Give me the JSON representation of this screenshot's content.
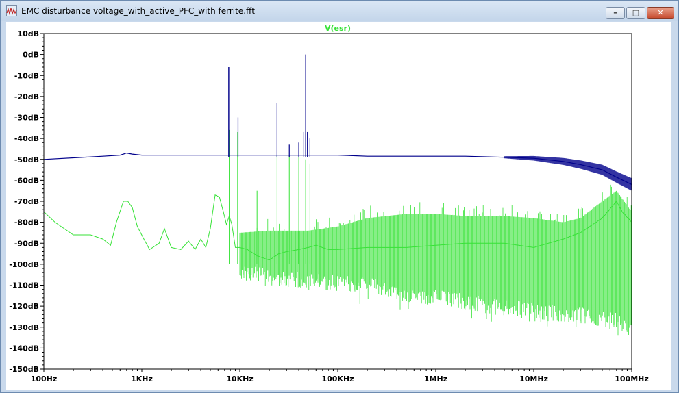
{
  "window": {
    "title": "EMC disturbance voltage_with_active_PFC_with ferrite.fft",
    "minimize_glyph": "–",
    "maximize_glyph": "□",
    "close_glyph": "✕"
  },
  "chart_data": {
    "type": "line",
    "title": "V(esr)",
    "x_scale": "log",
    "y_scale": "linear",
    "xlim": [
      100,
      100000000
    ],
    "ylim": [
      -150,
      10
    ],
    "x_ticks": [
      {
        "value": 100,
        "label": "100Hz"
      },
      {
        "value": 1000,
        "label": "1KHz"
      },
      {
        "value": 10000,
        "label": "10KHz"
      },
      {
        "value": 100000,
        "label": "100KHz"
      },
      {
        "value": 1000000,
        "label": "1MHz"
      },
      {
        "value": 10000000,
        "label": "10MHz"
      },
      {
        "value": 100000000,
        "label": "100MHz"
      }
    ],
    "y_ticks": [
      {
        "value": 10,
        "label": "10dB"
      },
      {
        "value": 0,
        "label": "0dB"
      },
      {
        "value": -10,
        "label": "-10dB"
      },
      {
        "value": -20,
        "label": "-20dB"
      },
      {
        "value": -30,
        "label": "-30dB"
      },
      {
        "value": -40,
        "label": "-40dB"
      },
      {
        "value": -50,
        "label": "-50dB"
      },
      {
        "value": -60,
        "label": "-60dB"
      },
      {
        "value": -70,
        "label": "-70dB"
      },
      {
        "value": -80,
        "label": "-80dB"
      },
      {
        "value": -90,
        "label": "-90dB"
      },
      {
        "value": -100,
        "label": "-100dB"
      },
      {
        "value": -110,
        "label": "-110dB"
      },
      {
        "value": -120,
        "label": "-120dB"
      },
      {
        "value": -130,
        "label": "-130dB"
      },
      {
        "value": -140,
        "label": "-140dB"
      },
      {
        "value": -150,
        "label": "-150dB"
      }
    ],
    "grid": false,
    "series": [
      {
        "name": "V(esr)",
        "color": "#37e237",
        "x": [
          100,
          130,
          200,
          300,
          400,
          480,
          550,
          650,
          720,
          800,
          900,
          1050,
          1200,
          1500,
          1700,
          2000,
          2500,
          3000,
          3500,
          4000,
          4500,
          5000,
          5600,
          6200,
          6800,
          7300,
          7800,
          8300,
          9000,
          10000,
          12000,
          15000,
          20000,
          25000,
          30000,
          40000,
          50000,
          60000,
          80000,
          100000,
          200000,
          500000,
          1000000,
          2000000,
          5000000,
          10000000,
          20000000,
          30000000,
          50000000,
          70000000,
          80000000,
          100000000
        ],
        "y": [
          -75,
          -80,
          -86,
          -86,
          -88,
          -91,
          -80,
          -70,
          -70,
          -73,
          -82,
          -88,
          -93,
          -90,
          -83,
          -92,
          -93,
          -89,
          -93,
          -88,
          -92,
          -83,
          -67,
          -68,
          -75,
          -81,
          -77,
          -81,
          -92,
          -92,
          -93,
          -96,
          -98,
          -95,
          -94,
          -93,
          -92,
          -91,
          -93,
          -93,
          -92,
          -92,
          -91,
          -90,
          -90,
          -92,
          -88,
          -85,
          -78,
          -70,
          -75,
          -80
        ],
        "lower": {
          "x": [
            10000,
            20000,
            50000,
            100000,
            200000,
            500000,
            1000000,
            2000000,
            5000000,
            10000000,
            20000000,
            40000000,
            70000000,
            100000000
          ],
          "y": [
            -100,
            -102,
            -104,
            -105,
            -106,
            -110,
            -112,
            -114,
            -117,
            -118,
            -120,
            -121,
            -123,
            -127
          ]
        },
        "upper": {
          "x": [
            10000,
            20000,
            50000,
            100000,
            200000,
            500000,
            1000000,
            2000000,
            5000000,
            10000000,
            20000000,
            30000000,
            50000000,
            70000000,
            100000000
          ],
          "y": [
            -85,
            -84,
            -84,
            -82,
            -78,
            -76,
            -76,
            -77,
            -77,
            -78,
            -80,
            -78,
            -70,
            -65,
            -75
          ]
        },
        "spikes": [
          {
            "x": 7800,
            "y": -36
          },
          {
            "x": 9500,
            "y": -37
          },
          {
            "x": 15000,
            "y": -65
          },
          {
            "x": 24000,
            "y": -48
          },
          {
            "x": 32000,
            "y": -48
          },
          {
            "x": 40000,
            "y": -48
          },
          {
            "x": 47000,
            "y": -50
          },
          {
            "x": 52000,
            "y": -52
          }
        ]
      },
      {
        "name": "V(esr)",
        "color": "#00008b",
        "x": [
          100,
          400,
          600,
          700,
          800,
          1000,
          2000,
          5000,
          7000,
          10000,
          20000,
          50000,
          100000,
          200000,
          500000,
          1000000,
          2000000,
          5000000,
          10000000,
          20000000,
          30000000,
          50000000,
          70000000,
          100000000
        ],
        "y": [
          -50,
          -48.5,
          -48,
          -47,
          -47.5,
          -48,
          -48,
          -48,
          -48,
          -48,
          -48,
          -48,
          -48,
          -48.5,
          -48.5,
          -48.5,
          -48.5,
          -49,
          -49.5,
          -51,
          -52.5,
          -55,
          -58.5,
          -62
        ],
        "spikes": [
          {
            "x": 7700,
            "y": -6
          },
          {
            "x": 7900,
            "y": -6
          },
          {
            "x": 9600,
            "y": -30
          },
          {
            "x": 24000,
            "y": -23
          },
          {
            "x": 32000,
            "y": -43
          },
          {
            "x": 40000,
            "y": -42
          },
          {
            "x": 45000,
            "y": -37
          },
          {
            "x": 47000,
            "y": 0
          },
          {
            "x": 49000,
            "y": -37
          },
          {
            "x": 52000,
            "y": -40
          }
        ]
      }
    ]
  }
}
